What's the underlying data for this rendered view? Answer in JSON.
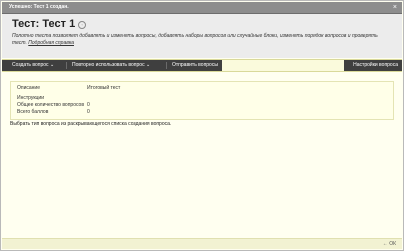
{
  "notice": {
    "text": "Успешно: Тест 1 создан.",
    "close_icon": "×"
  },
  "header": {
    "title": "Тест: Тест 1",
    "title_icon": "◦",
    "description": "Полотно теста позволяет добавлять и изменять вопросы, добавлять наборы вопросов или случайные блоки, изменять порядок вопросов и проверять тест.",
    "help_link": "Подробная справка"
  },
  "toolbar": {
    "create_question": "Создать вопрос",
    "reuse_question": "Повторно использовать вопрос",
    "upload_questions": "Отправить вопросы",
    "question_settings": "Настройки вопроса",
    "chevron": "⌄"
  },
  "info": {
    "rows": [
      {
        "label": "Описание",
        "value": "Итоговый тест"
      },
      {
        "label": "Инструкции",
        "value": ""
      },
      {
        "label": "Общее количество вопросов",
        "value": "0"
      },
      {
        "label": "Всего баллов",
        "value": "0"
      }
    ]
  },
  "hint": "Выбрать тип вопроса из раскрывающегося списка создания вопроса.",
  "footer": {
    "ok_label": "ОК",
    "ok_arrow": "←"
  }
}
